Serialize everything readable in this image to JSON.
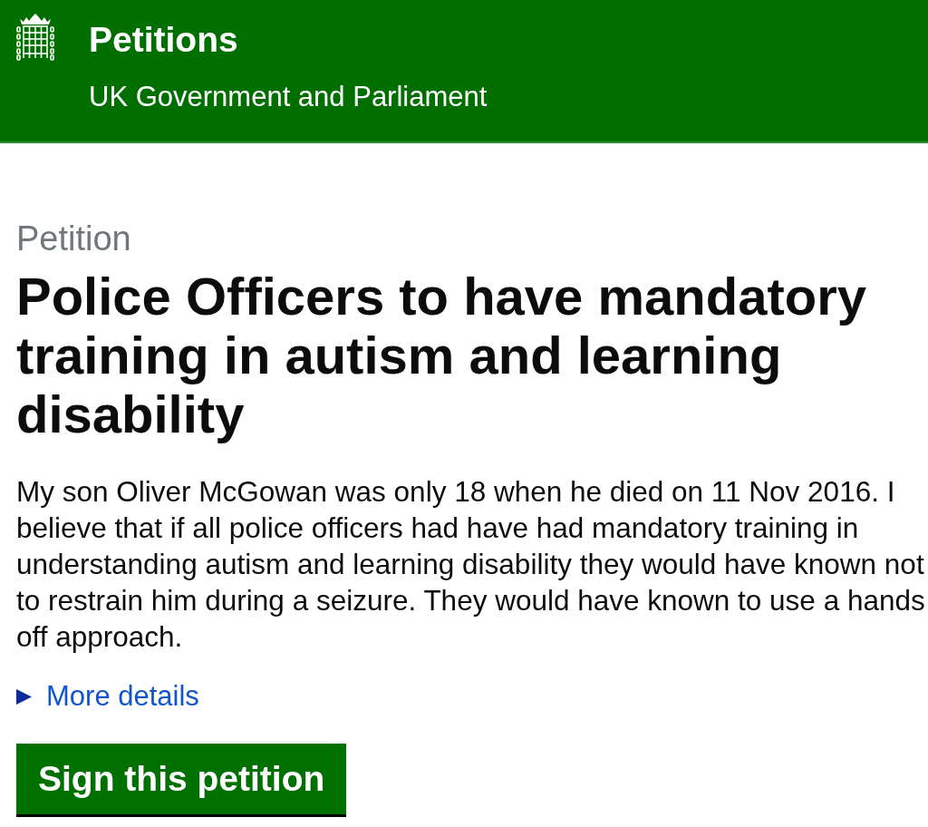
{
  "header": {
    "title": "Petitions",
    "subtitle": "UK Government and Parliament"
  },
  "petition": {
    "label": "Petition",
    "title": "Police Officers to have mandatory training in autism and learning disability",
    "summary": "My son Oliver McGowan was only 18 when he died on 11 Nov 2016. I believe that if all police officers had have had mandatory training in understanding autism and learning disability they would have known not to restrain him during a seizure. They would have known to use a hands off approach."
  },
  "details": {
    "label": "More details",
    "expanded": false
  },
  "sign_button": {
    "label": "Sign this petition"
  }
}
